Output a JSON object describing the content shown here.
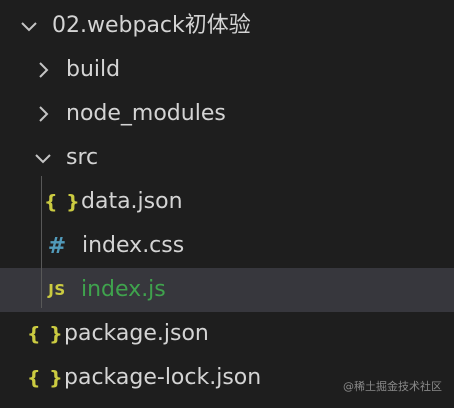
{
  "explorer": {
    "root": {
      "label": "02.webpack初体验",
      "icon": "chevron-down-icon"
    },
    "items": [
      {
        "label": "build",
        "icon": "chevron-right-icon"
      },
      {
        "label": "node_modules",
        "icon": "chevron-right-icon"
      },
      {
        "label": "src",
        "icon": "chevron-down-icon"
      },
      {
        "label": "data.json",
        "icon_text": "{ }"
      },
      {
        "label": "index.css",
        "icon_text": "#"
      },
      {
        "label": "index.js",
        "icon_text": "JS",
        "selected": true
      },
      {
        "label": "package.json",
        "icon_text": "{ }"
      },
      {
        "label": "package-lock.json",
        "icon_text": "{ }"
      }
    ]
  },
  "colors": {
    "background": "#1e1e1e",
    "selected_row": "#37373d",
    "json_icon": "#cbcb41",
    "css_icon": "#519aba",
    "selected_text": "#3fa34d"
  },
  "watermark": "@稀土掘金技术社区"
}
